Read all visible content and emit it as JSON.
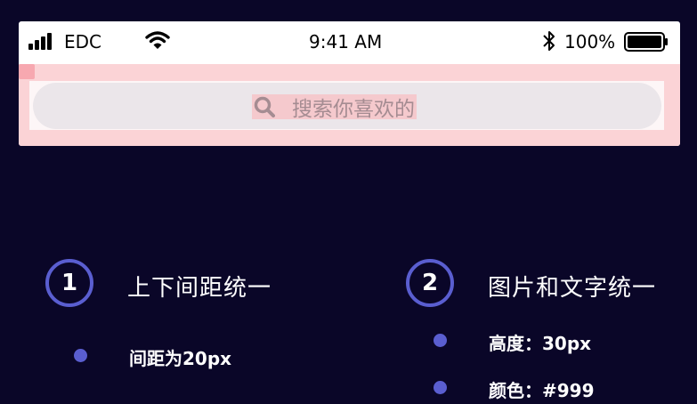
{
  "status_bar": {
    "carrier": "EDC",
    "time": "9:41 AM",
    "battery": "100%"
  },
  "search": {
    "placeholder": "搜索你喜欢的"
  },
  "sections": [
    {
      "number": "1",
      "title": "上下间距统一",
      "bullets": [
        "间距为20px"
      ]
    },
    {
      "number": "2",
      "title": "图片和文字统一",
      "bullets": [
        "高度：30px",
        "颜色：#999"
      ]
    }
  ],
  "colors": {
    "background": "#0a0628",
    "accent": "#5a5ed0",
    "highlight": "#fbd3d6"
  },
  "icons": [
    "signal-icon",
    "wifi-icon",
    "bluetooth-icon",
    "battery-icon",
    "search-icon"
  ]
}
